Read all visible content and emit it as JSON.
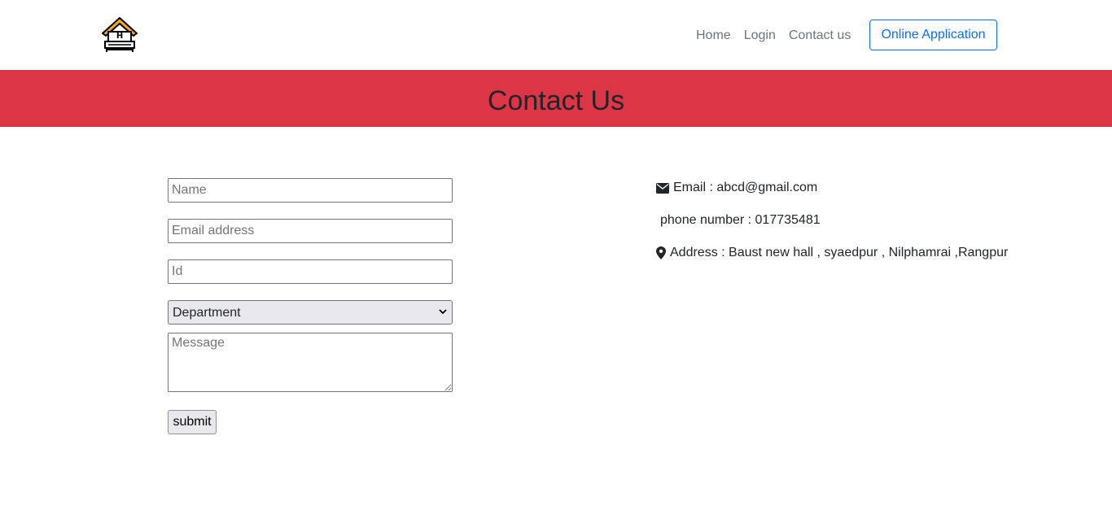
{
  "nav": {
    "logo_icon": "house-hostel-logo-icon",
    "links": [
      "Home",
      "Login",
      "Contact us"
    ],
    "cta_label": "Online Application"
  },
  "banner": {
    "title": "Contact Us",
    "background": "#dc3545"
  },
  "form": {
    "name_placeholder": "Name",
    "email_placeholder": "Email address",
    "id_placeholder": "Id",
    "department_selected": "Department",
    "message_placeholder": "Message",
    "submit_label": "submit"
  },
  "contact": {
    "email_label": "Email : abcd@gmail.com",
    "email_icon": "envelope-icon",
    "phone_label": "phone number : 017735481",
    "address_label": "Address : Baust new hall , syaedpur , Nilphamrai ,Rangpur",
    "address_icon": "map-marker-icon"
  },
  "colors": {
    "accent": "#0d6efd",
    "banner": "#dc3545",
    "nav_text": "#6c757d"
  }
}
